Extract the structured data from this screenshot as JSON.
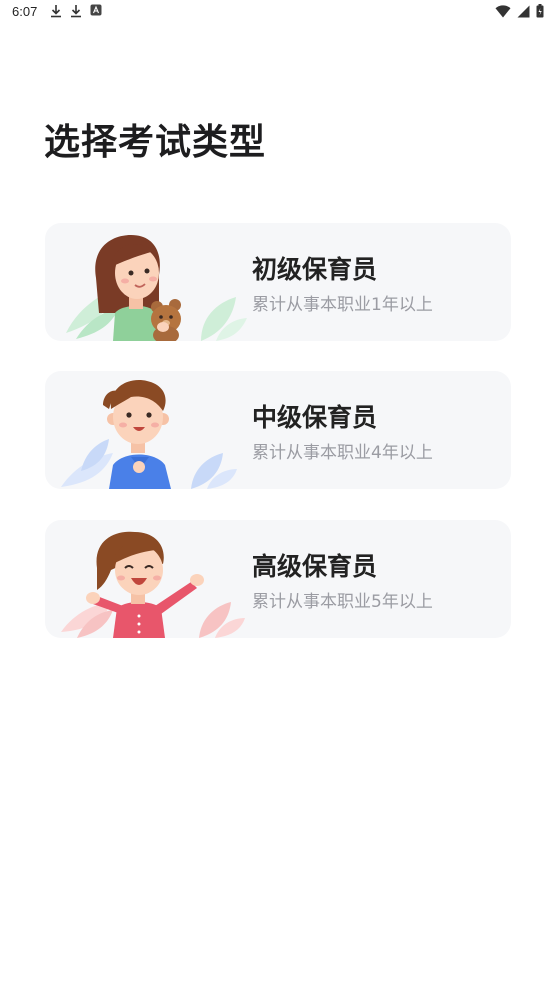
{
  "status_bar": {
    "time": "6:07",
    "left_icons": [
      "download-icon",
      "download-icon",
      "app-notification-icon"
    ],
    "right_icons": [
      "wifi-icon",
      "signal-icon",
      "battery-icon"
    ]
  },
  "page": {
    "title": "选择考试类型"
  },
  "exam_types": [
    {
      "title": "初级保育员",
      "subtitle": "累计从事本职业1年以上",
      "illustration": "girl-with-teddy-bear",
      "accent_color": "#8fd09a"
    },
    {
      "title": "中级保育员",
      "subtitle": "累计从事本职业4年以上",
      "illustration": "boy-in-blue",
      "accent_color": "#4a80e8"
    },
    {
      "title": "高级保育员",
      "subtitle": "累计从事本职业5年以上",
      "illustration": "girl-in-pink-cheering",
      "accent_color": "#e8566b"
    }
  ],
  "colors": {
    "card_background": "#f6f7f9",
    "title_text": "#222222",
    "subtitle_text": "#9b9ca3"
  }
}
